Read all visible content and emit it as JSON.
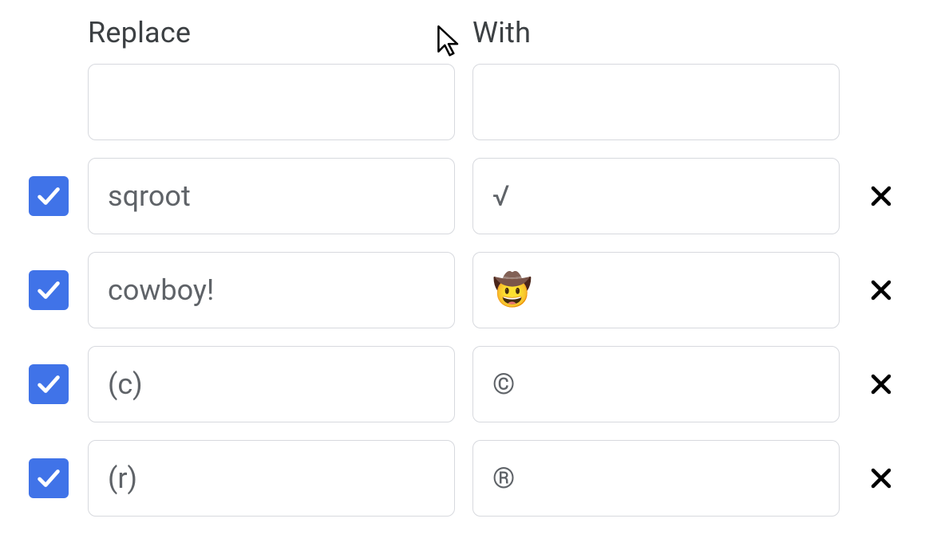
{
  "headers": {
    "replace": "Replace",
    "with": "With"
  },
  "new_row": {
    "replace_value": "",
    "with_value": ""
  },
  "rows": [
    {
      "checked": true,
      "replace": "sqroot",
      "with": "√"
    },
    {
      "checked": true,
      "replace": "cowboy!",
      "with": "🤠"
    },
    {
      "checked": true,
      "replace": "(c)",
      "with": "©"
    },
    {
      "checked": true,
      "replace": "(r)",
      "with": "®"
    }
  ]
}
